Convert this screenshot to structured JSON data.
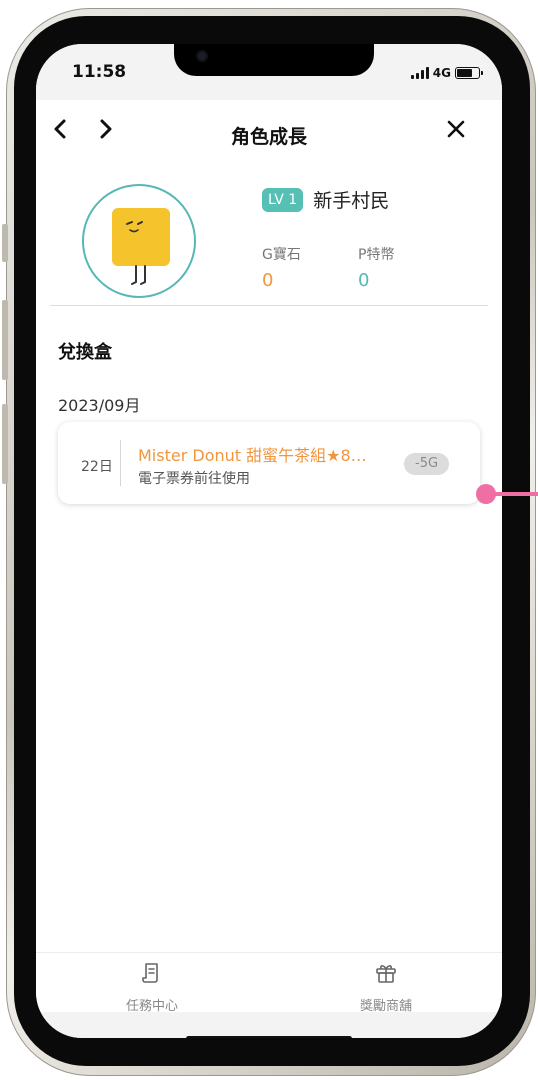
{
  "status_bar": {
    "time": "11:58",
    "network": "4G"
  },
  "header": {
    "title": "角色成長",
    "back_icon": "chevron-left-icon",
    "forward_icon": "chevron-right-icon",
    "close_icon": "close-icon"
  },
  "profile": {
    "level": "LV 1",
    "name": "新手村民",
    "stats": [
      {
        "label": "G寶石",
        "value": "0",
        "color": "#f0963f"
      },
      {
        "label": "P特幣",
        "value": "0",
        "color": "#55b8b5"
      }
    ],
    "avatar_color": "#f5c32c"
  },
  "exchange_box": {
    "title": "兌換盒",
    "month": "2023/09月",
    "items": [
      {
        "day": "22日",
        "title": "Mister Donut 甜蜜午茶組★8…",
        "subtitle": "電子票券前往使用",
        "cost": "-5G"
      }
    ]
  },
  "tabbar": {
    "tabs": [
      {
        "label": "任務中心",
        "icon": "scroll-icon"
      },
      {
        "label": "獎勵商舖",
        "icon": "gift-icon"
      }
    ]
  },
  "colors": {
    "accent_teal": "#55c0b3",
    "accent_orange": "#f0963f",
    "annotation_pink": "#ef6fa5"
  }
}
